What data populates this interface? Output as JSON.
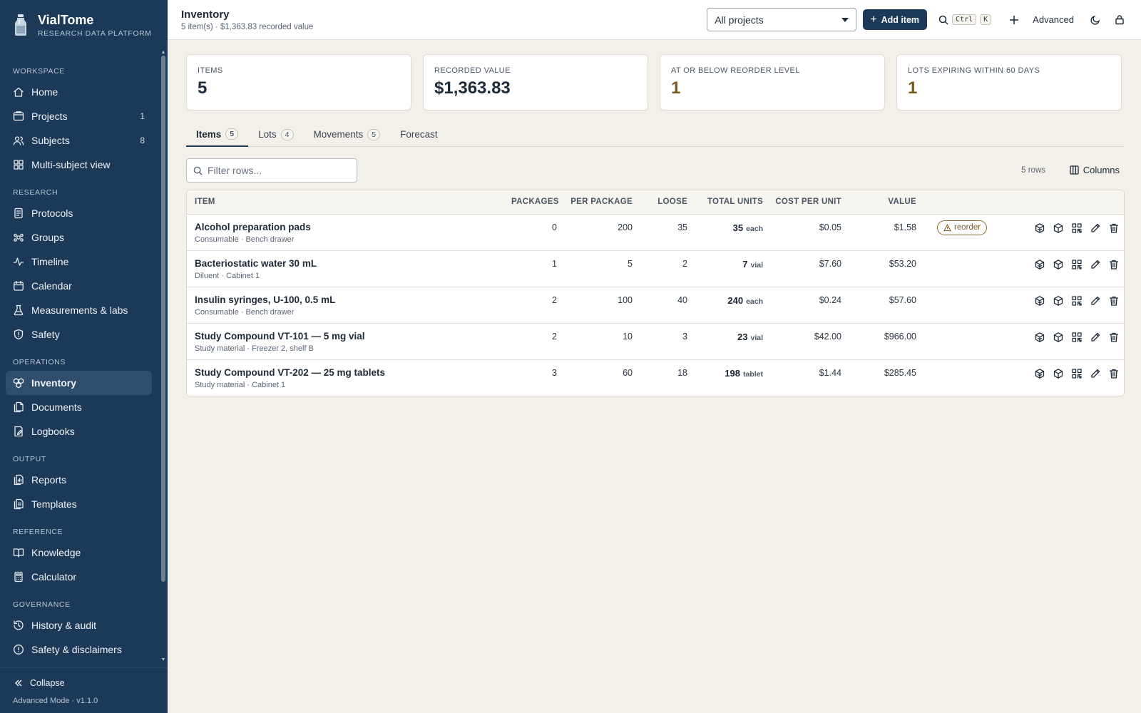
{
  "brand": {
    "name": "VialTome",
    "subtitle": "RESEARCH DATA PLATFORM"
  },
  "sidebar": {
    "sections": [
      {
        "label": "WORKSPACE",
        "items": [
          {
            "label": "Home",
            "icon": "home-icon",
            "count": ""
          },
          {
            "label": "Projects",
            "icon": "projects-icon",
            "count": "1"
          },
          {
            "label": "Subjects",
            "icon": "subjects-icon",
            "count": "8"
          },
          {
            "label": "Multi-subject view",
            "icon": "grid-icon",
            "count": ""
          }
        ]
      },
      {
        "label": "RESEARCH",
        "items": [
          {
            "label": "Protocols",
            "icon": "protocols-icon",
            "count": ""
          },
          {
            "label": "Groups",
            "icon": "groups-icon",
            "count": ""
          },
          {
            "label": "Timeline",
            "icon": "timeline-icon",
            "count": ""
          },
          {
            "label": "Calendar",
            "icon": "calendar-icon",
            "count": ""
          },
          {
            "label": "Measurements & labs",
            "icon": "flask-icon",
            "count": ""
          },
          {
            "label": "Safety",
            "icon": "shield-icon",
            "count": ""
          }
        ]
      },
      {
        "label": "OPERATIONS",
        "items": [
          {
            "label": "Inventory",
            "icon": "inventory-icon",
            "count": "",
            "active": true
          },
          {
            "label": "Documents",
            "icon": "documents-icon",
            "count": ""
          },
          {
            "label": "Logbooks",
            "icon": "logbook-icon",
            "count": ""
          }
        ]
      },
      {
        "label": "OUTPUT",
        "items": [
          {
            "label": "Reports",
            "icon": "reports-icon",
            "count": ""
          },
          {
            "label": "Templates",
            "icon": "templates-icon",
            "count": ""
          }
        ]
      },
      {
        "label": "REFERENCE",
        "items": [
          {
            "label": "Knowledge",
            "icon": "book-icon",
            "count": ""
          },
          {
            "label": "Calculator",
            "icon": "calculator-icon",
            "count": ""
          }
        ]
      },
      {
        "label": "GOVERNANCE",
        "items": [
          {
            "label": "History & audit",
            "icon": "history-icon",
            "count": ""
          },
          {
            "label": "Safety & disclaimers",
            "icon": "info-icon",
            "count": ""
          }
        ]
      }
    ],
    "collapse_label": "Collapse",
    "version": "Advanced Mode · v1.1.0"
  },
  "header": {
    "title": "Inventory",
    "subtitle": "5 item(s) · $1,363.83 recorded value",
    "project_select": "All projects",
    "add_label": "Add item",
    "kbd_ctrl": "Ctrl",
    "kbd_k": "K",
    "advanced_label": "Advanced"
  },
  "cards": [
    {
      "label": "ITEMS",
      "value": "5",
      "warn": false
    },
    {
      "label": "RECORDED VALUE",
      "value": "$1,363.83",
      "warn": false
    },
    {
      "label": "AT OR BELOW REORDER LEVEL",
      "value": "1",
      "warn": true
    },
    {
      "label": "LOTS EXPIRING WITHIN 60 DAYS",
      "value": "1",
      "warn": true
    }
  ],
  "tabs": [
    {
      "label": "Items",
      "badge": "5",
      "active": true
    },
    {
      "label": "Lots",
      "badge": "4",
      "active": false
    },
    {
      "label": "Movements",
      "badge": "5",
      "active": false
    },
    {
      "label": "Forecast",
      "badge": "",
      "active": false
    }
  ],
  "filter": {
    "placeholder": "Filter rows..."
  },
  "rows_count": "5 rows",
  "columns_label": "Columns",
  "table": {
    "columns": [
      "ITEM",
      "PACKAGES",
      "PER PACKAGE",
      "LOOSE",
      "TOTAL UNITS",
      "COST PER UNIT",
      "VALUE"
    ],
    "rows": [
      {
        "name": "Alcohol preparation pads",
        "meta": "Consumable · Bench drawer",
        "packages": "0",
        "per_package": "200",
        "loose": "35",
        "total": "35",
        "unit": "each",
        "cost": "$0.05",
        "value": "$1.58",
        "badge": "reorder"
      },
      {
        "name": "Bacteriostatic water 30 mL",
        "meta": "Diluent · Cabinet 1",
        "packages": "1",
        "per_package": "5",
        "loose": "2",
        "total": "7",
        "unit": "vial",
        "cost": "$7.60",
        "value": "$53.20",
        "badge": ""
      },
      {
        "name": "Insulin syringes, U-100, 0.5 mL",
        "meta": "Consumable · Bench drawer",
        "packages": "2",
        "per_package": "100",
        "loose": "40",
        "total": "240",
        "unit": "each",
        "cost": "$0.24",
        "value": "$57.60",
        "badge": ""
      },
      {
        "name": "Study Compound VT-101 — 5 mg vial",
        "meta": "Study material · Freezer 2, shelf B",
        "packages": "2",
        "per_package": "10",
        "loose": "3",
        "total": "23",
        "unit": "vial",
        "cost": "$42.00",
        "value": "$966.00",
        "badge": ""
      },
      {
        "name": "Study Compound VT-202 — 25 mg tablets",
        "meta": "Study material · Cabinet 1",
        "packages": "3",
        "per_package": "60",
        "loose": "18",
        "total": "198",
        "unit": "tablet",
        "cost": "$1.44",
        "value": "$285.45",
        "badge": ""
      }
    ]
  }
}
